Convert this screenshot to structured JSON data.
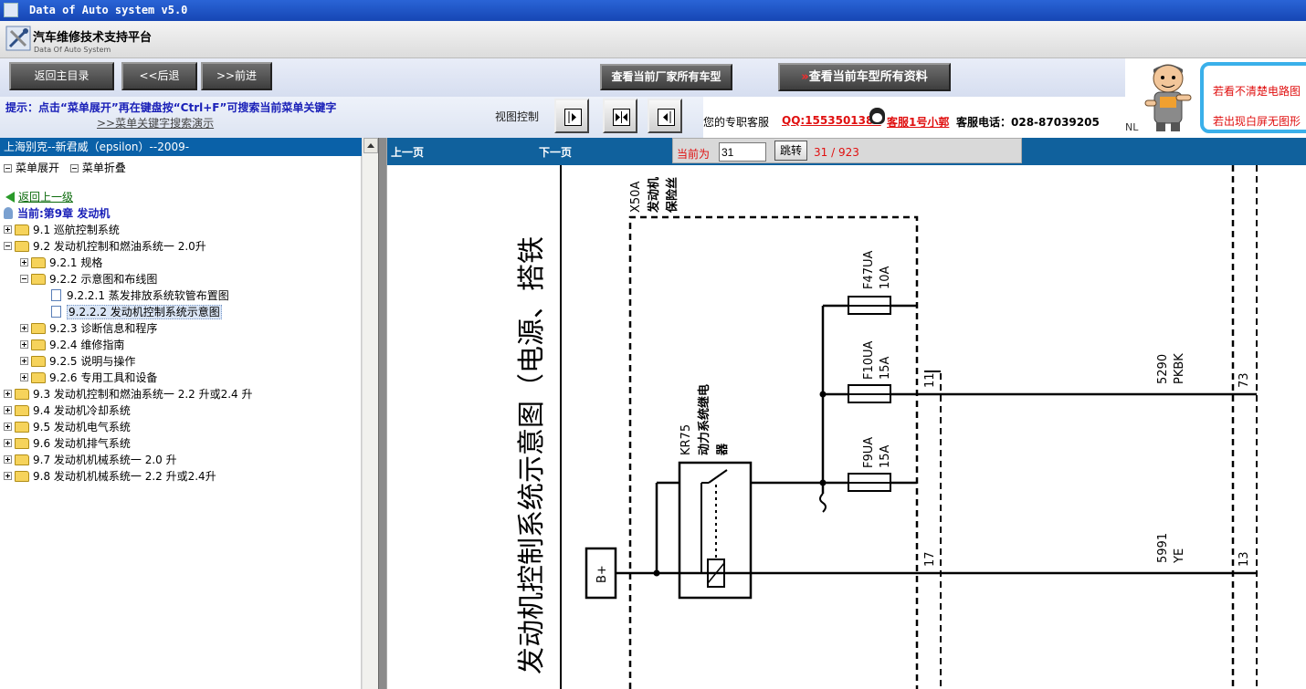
{
  "window": {
    "title": "Data of Auto system v5.0"
  },
  "brand": {
    "name_cn": "汽车维修技术支持平台",
    "name_en": "Data Of Auto System"
  },
  "nav": {
    "main_menu": "返回主目录",
    "back": "<<后退",
    "forward": ">>前进",
    "view_models": "查看当前厂家所有车型",
    "all_info_arrow": "»",
    "all_info": "查看当前车型所有资料"
  },
  "hint": {
    "text": "提示：点击“菜单展开”再在键盘按“Ctrl+F”可搜索当前菜单关键字",
    "link": ">>菜单关键字搜索演示"
  },
  "view_control": {
    "label": "视图控制"
  },
  "service": {
    "label": "您的专职客服",
    "qq": "QQ:1553501388",
    "kefu": "客服1号小郭",
    "tel": "客服电话：028-87039205"
  },
  "ad": {
    "nl": "NL",
    "line1": "若看不清楚电路图",
    "line2": "若出现白屏无图形"
  },
  "tree": {
    "header": "上海别克--新君威（epsilon）--2009-",
    "expand": "菜单展开",
    "collapse": "菜单折叠",
    "back_up": "返回上一级",
    "current": "当前:第9章  发动机",
    "items": [
      {
        "label": "9.1 巡航控制系统"
      },
      {
        "label": "9.2 发动机控制和燃油系统一 2.0升"
      },
      {
        "label": "9.2.1 规格"
      },
      {
        "label": "9.2.2 示意图和布线图"
      },
      {
        "label": "9.2.2.1 蒸发排放系统软管布置图"
      },
      {
        "label": "9.2.2.2 发动机控制系统示意图"
      },
      {
        "label": "9.2.3 诊断信息和程序"
      },
      {
        "label": "9.2.4 维修指南"
      },
      {
        "label": "9.2.5 说明与操作"
      },
      {
        "label": "9.2.6 专用工具和设备"
      },
      {
        "label": "9.3 发动机控制和燃油系统一 2.2 升或2.4 升"
      },
      {
        "label": "9.4 发动机冷却系统"
      },
      {
        "label": "9.5 发动机电气系统"
      },
      {
        "label": "9.6 发动机排气系统"
      },
      {
        "label": "9.7 发动机机械系统一 2.0 升"
      },
      {
        "label": "9.8 发动机机械系统一 2.2 升或2.4升"
      }
    ]
  },
  "pager": {
    "prev": "上一页",
    "next": "下一页",
    "current_label": "当前为",
    "current_value": "31",
    "jump": "跳转",
    "count": "31 / 923"
  },
  "diagram": {
    "title": "发动机控制系统示意图（电源、搭铁",
    "x50a": "X50A",
    "x50a_sub1": "发动机",
    "x50a_sub2": "保险丝",
    "f47ua": "F47UA",
    "f47ua_rating": "10A",
    "f10ua": "F10UA",
    "f10ua_rating": "15A",
    "f9ua": "F9UA",
    "f9ua_rating": "15A",
    "kr75": "KR75",
    "kr75_name1": "动力系统继电",
    "kr75_name2": "器",
    "bplus": "B+",
    "pin11": "11",
    "pin17": "17",
    "wire1_code": "5290",
    "wire1_color": "PKBK",
    "wire1_pin": "73",
    "wire2_code": "5991",
    "wire2_color": "YE",
    "wire2_pin": "13"
  }
}
